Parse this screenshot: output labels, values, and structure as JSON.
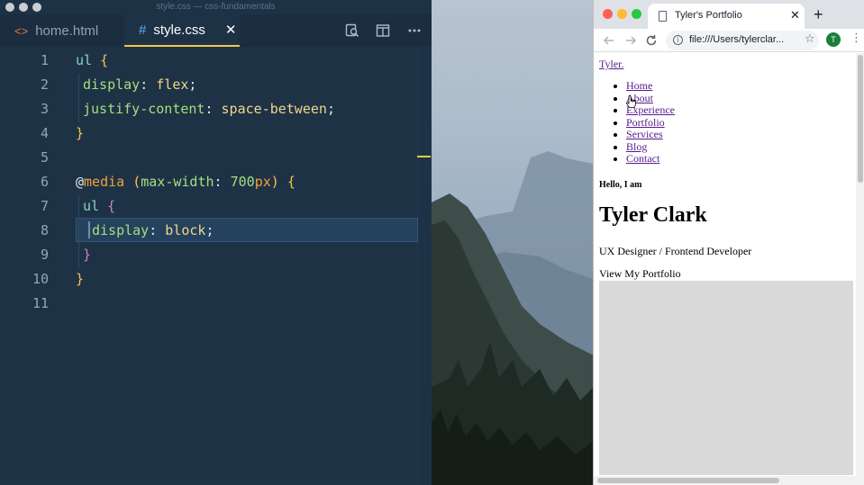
{
  "editor": {
    "window_title": "style.css — css-fundamentals",
    "tabs": [
      {
        "label": "home.html",
        "icon": "code-brackets-icon"
      },
      {
        "label": "style.css",
        "icon": "hash-icon",
        "close": "✕"
      }
    ],
    "toolbar_icons": [
      "search-in-files-icon",
      "split-editor-icon",
      "more-actions-icon"
    ],
    "line_numbers": [
      "1",
      "2",
      "3",
      "4",
      "5",
      "6",
      "7",
      "8",
      "9",
      "10",
      "11"
    ],
    "code": {
      "l1": {
        "selector": "ul",
        "brace": "{"
      },
      "l2": {
        "property": "display",
        "colon": ":",
        "value": "flex",
        "semi": ";"
      },
      "l3": {
        "property": "justify-content",
        "colon": ":",
        "value": "space-between",
        "semi": ";"
      },
      "l4": {
        "brace": "}"
      },
      "l6": {
        "at": "@",
        "keyword": "media",
        "open": "(",
        "feature": "max-width",
        "colon": ":",
        "number": "700",
        "unit": "px",
        "close": ")",
        "brace": "{"
      },
      "l7": {
        "selector": "ul",
        "brace": "{"
      },
      "l8": {
        "property": "display",
        "colon": ":",
        "value": "block",
        "semi": ";"
      },
      "l9": {
        "brace": "}"
      },
      "l10": {
        "brace": "}"
      }
    },
    "active_line": "8",
    "colors": {
      "background": "#1e3246",
      "accent": "#f5c648",
      "selector": "#87d4c9",
      "property": "#a5df7d",
      "value": "#f0d68a",
      "at_rule": "#f2a13b"
    }
  },
  "browser": {
    "tab_title": "Tyler's Portfolio",
    "tab_close": "✕",
    "new_tab": "+",
    "url": "file:///Users/tylerclar...",
    "avatar_initial": "T",
    "nav_icons": [
      "back-arrow-icon",
      "forward-arrow-icon",
      "reload-icon",
      "info-icon",
      "bookmark-star-icon",
      "kebab-menu-icon"
    ],
    "page": {
      "logo": "Tyler.",
      "nav_items": [
        "Home",
        "About",
        "Experience",
        "Portfolio",
        "Services",
        "Blog",
        "Contact"
      ],
      "greeting": "Hello, I am",
      "name": "Tyler Clark",
      "role": "UX Designer / Frontend Developer",
      "cta": "View My Portfolio"
    },
    "colors": {
      "link": "#551a8b",
      "placeholder_image": "#d9d9d9"
    }
  }
}
